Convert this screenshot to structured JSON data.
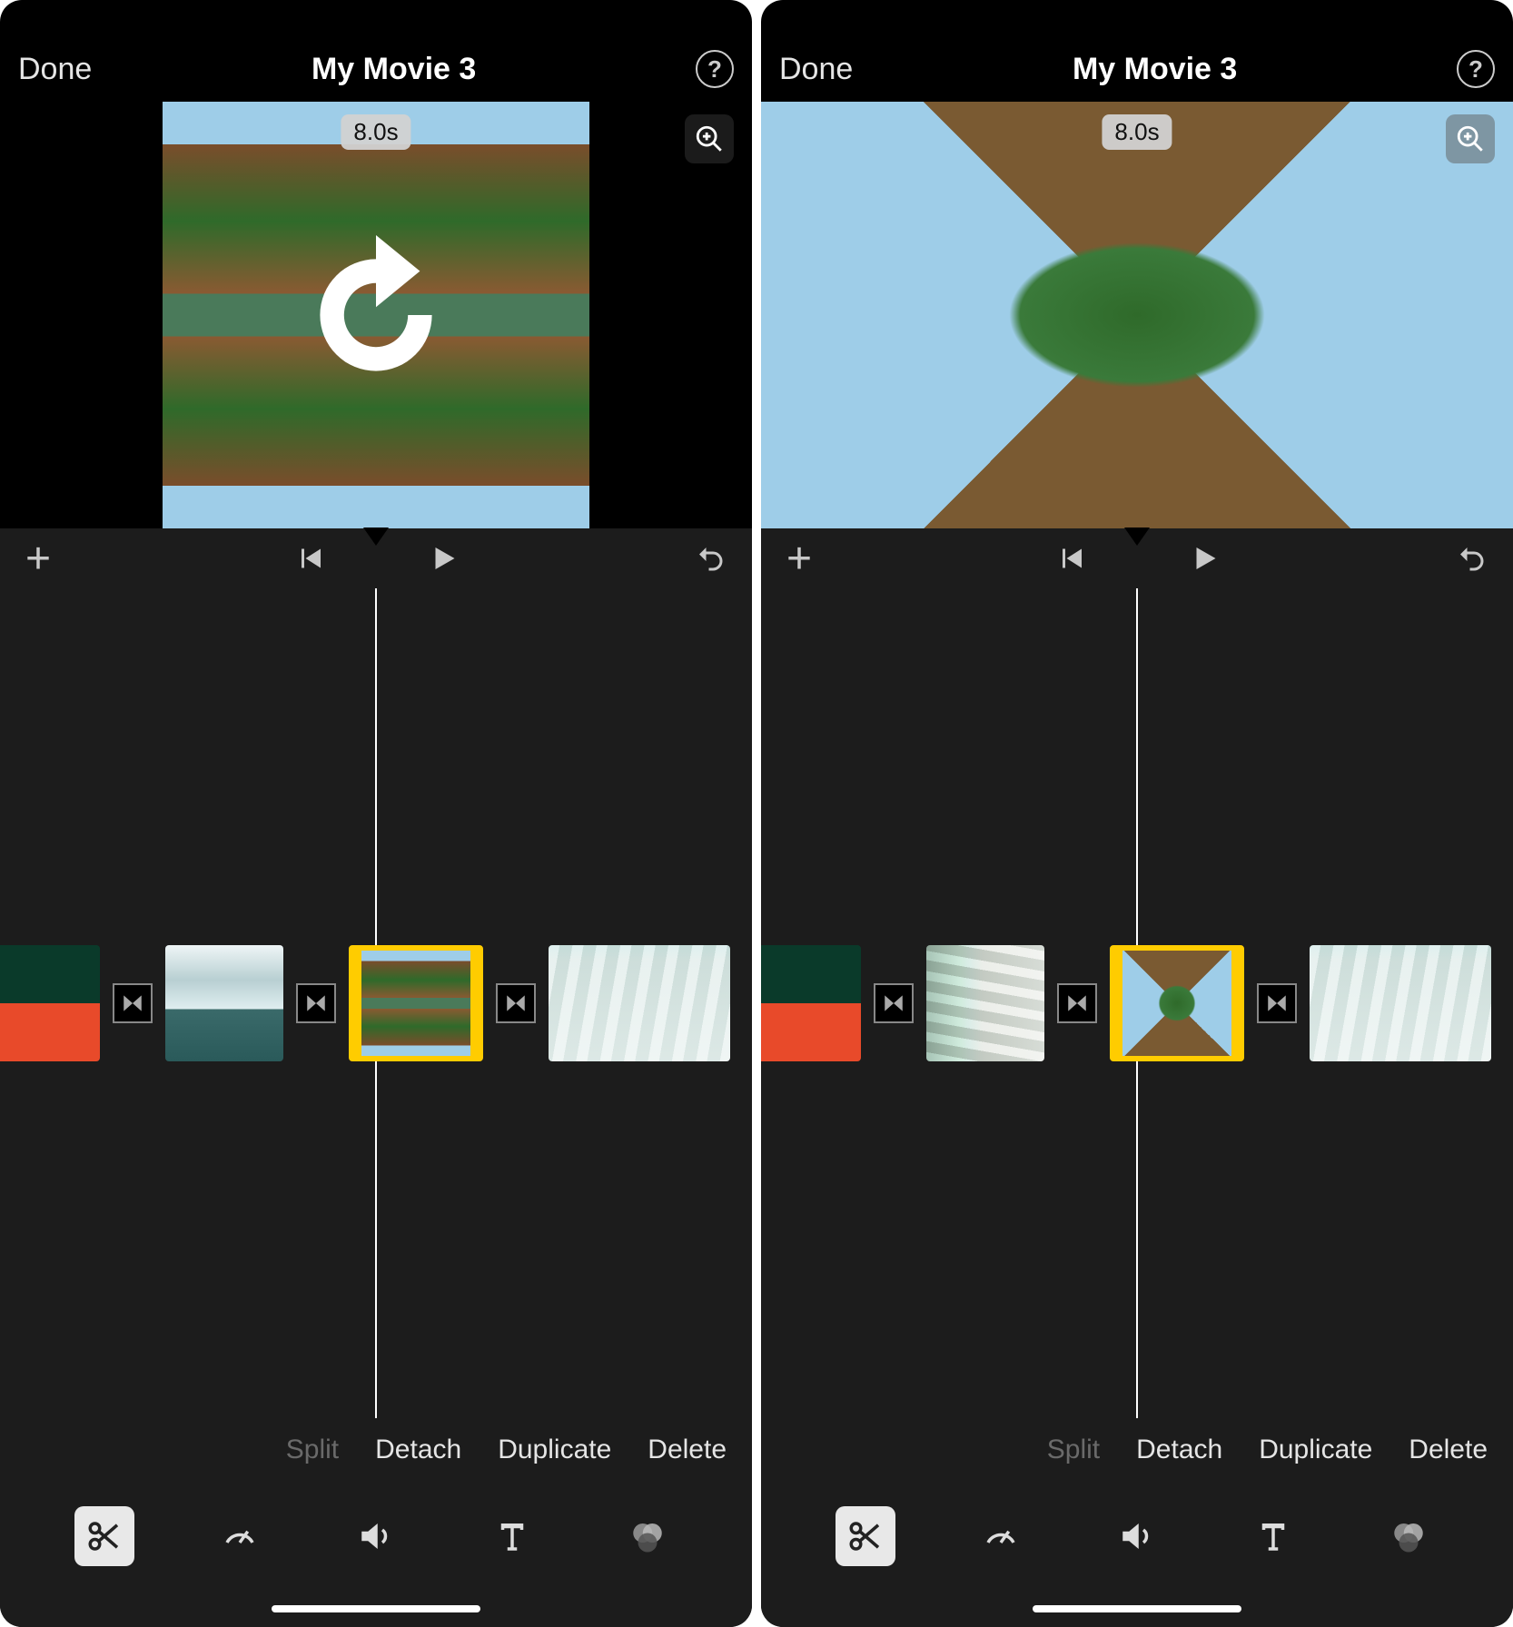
{
  "screens": [
    {
      "done_label": "Done",
      "title": "My Movie 3",
      "duration_badge": "8.0s",
      "preview_style": "narrow",
      "show_rotate_overlay": true,
      "zoom_style": "dark",
      "edit_actions": {
        "split": "Split",
        "detach": "Detach",
        "duplicate": "Duplicate",
        "delete": "Delete"
      },
      "split_disabled": true
    },
    {
      "done_label": "Done",
      "title": "My Movie 3",
      "duration_badge": "8.0s",
      "preview_style": "full",
      "show_rotate_overlay": false,
      "zoom_style": "light",
      "edit_actions": {
        "split": "Split",
        "detach": "Detach",
        "duplicate": "Duplicate",
        "delete": "Delete"
      },
      "split_disabled": true
    }
  ],
  "tools": [
    "scissors",
    "speed",
    "volume",
    "text",
    "filters"
  ],
  "active_tool": "scissors"
}
